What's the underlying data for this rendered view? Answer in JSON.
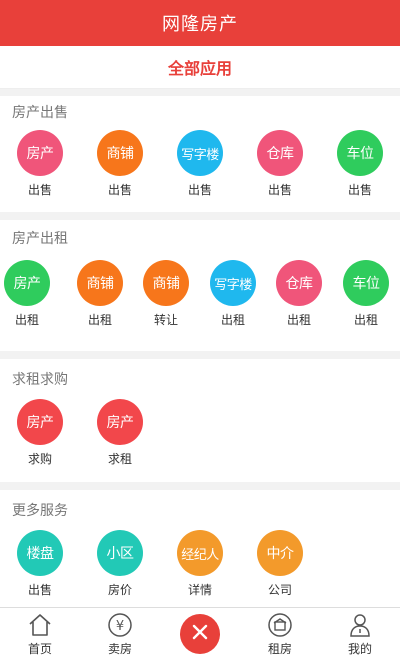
{
  "header": {
    "title": "网隆房产"
  },
  "subtitle": "全部应用",
  "sections": [
    {
      "title": "房产出售",
      "items": [
        {
          "icon_text": "房产",
          "caption": "出售",
          "color": "#f0557a"
        },
        {
          "icon_text": "商铺",
          "caption": "出售",
          "color": "#f7761b"
        },
        {
          "icon_text": "写字楼",
          "caption": "出售",
          "color": "#1fb8ee"
        },
        {
          "icon_text": "仓库",
          "caption": "出售",
          "color": "#f0557a"
        },
        {
          "icon_text": "车位",
          "caption": "出售",
          "color": "#2fcc5d"
        }
      ]
    },
    {
      "title": "房产出租",
      "items": [
        {
          "icon_text": "房产",
          "caption": "出租",
          "color": "#2fcc5d"
        },
        {
          "icon_text": "商铺",
          "caption": "出租",
          "color": "#f7761b"
        },
        {
          "icon_text": "商铺",
          "caption": "转让",
          "color": "#f7761b"
        },
        {
          "icon_text": "写字楼",
          "caption": "出租",
          "color": "#1fb8ee"
        },
        {
          "icon_text": "仓库",
          "caption": "出租",
          "color": "#f0557a"
        },
        {
          "icon_text": "车位",
          "caption": "出租",
          "color": "#2fcc5d"
        }
      ]
    },
    {
      "title": "求租求购",
      "items": [
        {
          "icon_text": "房产",
          "caption": "求购",
          "color": "#f2474b"
        },
        {
          "icon_text": "房产",
          "caption": "求租",
          "color": "#f2474b"
        }
      ]
    },
    {
      "title": "更多服务",
      "items": [
        {
          "icon_text": "楼盘",
          "caption": "出售",
          "color": "#22c9b6"
        },
        {
          "icon_text": "小区",
          "caption": "房价",
          "color": "#22c9b6"
        },
        {
          "icon_text": "经纪人",
          "caption": "详情",
          "color": "#f39a2b"
        },
        {
          "icon_text": "中介",
          "caption": "公司",
          "color": "#f39a2b"
        }
      ]
    }
  ],
  "tabbar": {
    "items": [
      {
        "label": "首页",
        "icon": "home-icon"
      },
      {
        "label": "卖房",
        "icon": "yen-icon"
      },
      {
        "label": "",
        "icon": "close-icon"
      },
      {
        "label": "租房",
        "icon": "rent-icon"
      },
      {
        "label": "我的",
        "icon": "user-icon"
      }
    ],
    "accent": "#e8403a"
  }
}
